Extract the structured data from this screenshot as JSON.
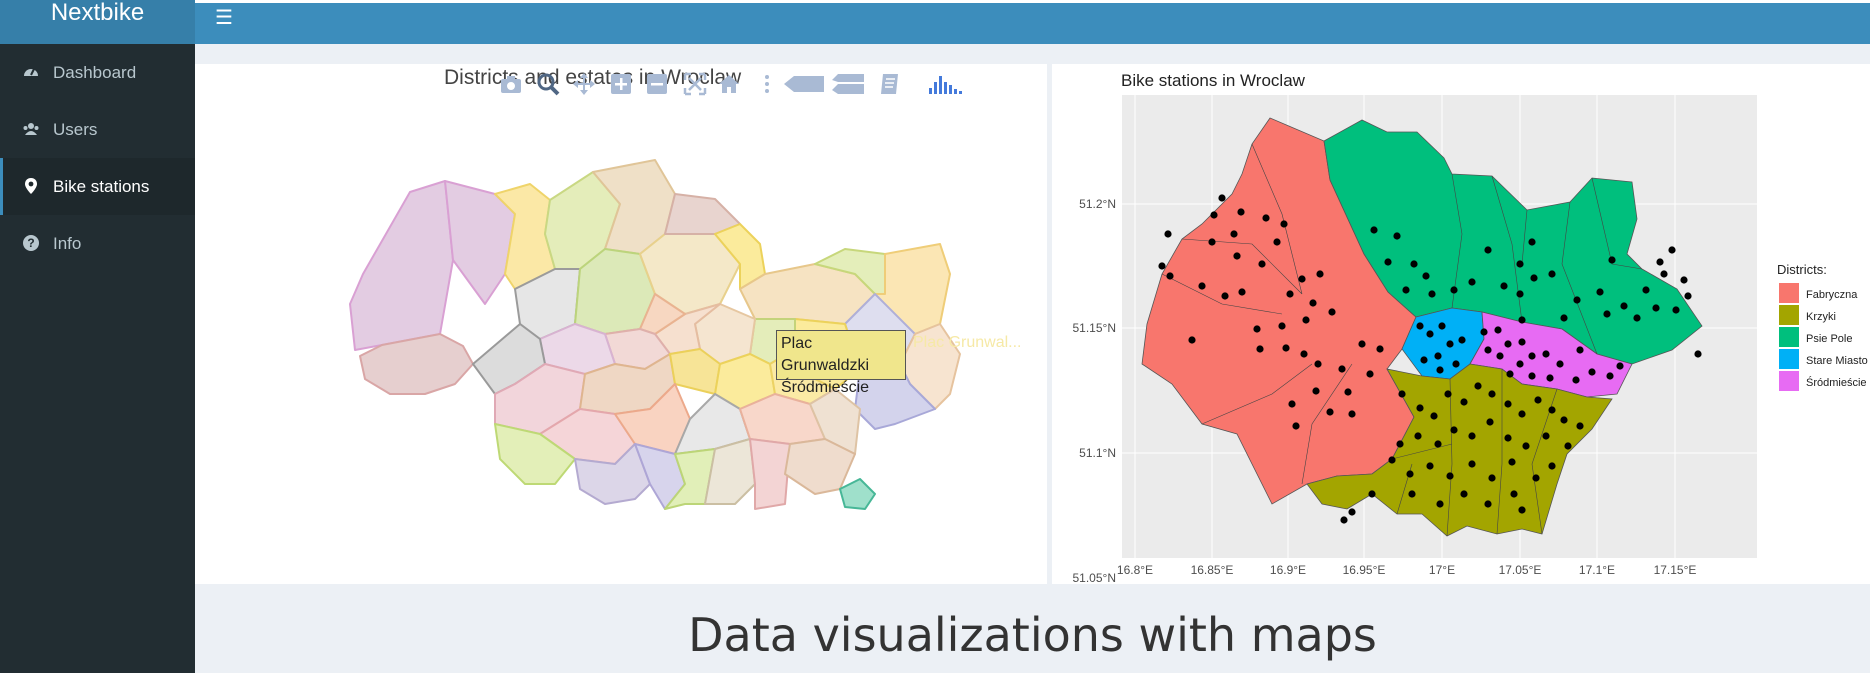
{
  "app": {
    "name": "Nextbike"
  },
  "sidebar": {
    "items": [
      {
        "label": "Dashboard",
        "icon": "dashboard-icon"
      },
      {
        "label": "Users",
        "icon": "users-icon"
      },
      {
        "label": "Bike stations",
        "icon": "map-marker-icon",
        "active": true
      },
      {
        "label": "Info",
        "icon": "question-circle-icon"
      }
    ]
  },
  "left_plot": {
    "title": "Districts and estates in Wroclaw",
    "tooltip": {
      "line1": "Plac Grunwaldzki",
      "line2": "Śródmieście"
    },
    "ghost_label": "Plac Grunwal...",
    "modebar": [
      "camera-icon",
      "zoom-icon",
      "pan-icon",
      "zoom-in-icon",
      "zoom-out-icon",
      "autoscale-icon",
      "home-icon",
      "spike-icon",
      "hover-closest-icon",
      "hover-compare-icon",
      "toggle-hover-icon",
      "plotly-logo-icon"
    ]
  },
  "right_plot": {
    "title": "Bike stations in Wroclaw",
    "y_ticks": [
      "51.2°N",
      "51.15°N",
      "51.1°N",
      "51.05°N"
    ],
    "x_ticks": [
      "16.8°E",
      "16.85°E",
      "16.9°E",
      "16.95°E",
      "17°E",
      "17.05°E",
      "17.1°E",
      "17.15°E"
    ],
    "legend": {
      "title": "Districts:",
      "items": [
        {
          "label": "Fabryczna",
          "color": "#F8766D"
        },
        {
          "label": "Krzyki",
          "color": "#A3A500"
        },
        {
          "label": "Psie Pole",
          "color": "#00BF7D"
        },
        {
          "label": "Stare Miasto",
          "color": "#00B0F6"
        },
        {
          "label": "Śródmieście",
          "color": "#E76BF3"
        }
      ]
    }
  },
  "page_heading": "Data visualizations with maps"
}
